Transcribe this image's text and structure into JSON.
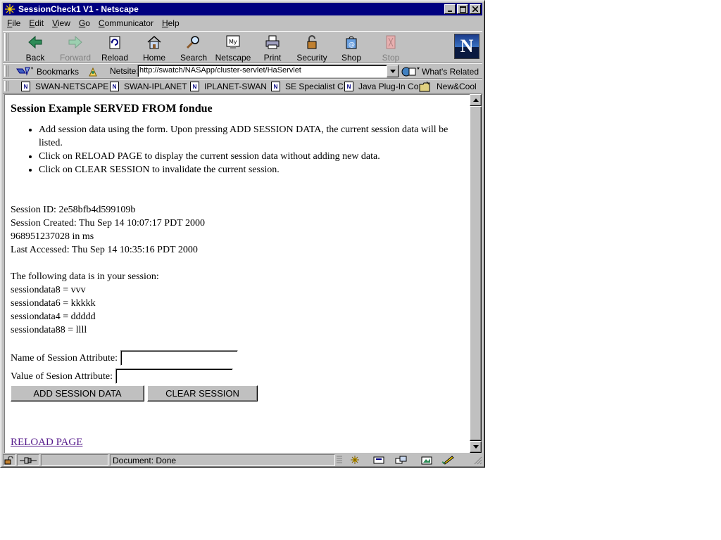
{
  "window": {
    "title": "SessionCheck1 V1 - Netscape",
    "controls": {
      "minimize": "_",
      "maximize": "□",
      "close": "×"
    }
  },
  "menu": [
    {
      "label": "File",
      "accel": "F",
      "rest": "ile"
    },
    {
      "label": "Edit",
      "accel": "E",
      "rest": "dit"
    },
    {
      "label": "View",
      "accel": "V",
      "rest": "iew"
    },
    {
      "label": "Go",
      "accel": "G",
      "rest": "o"
    },
    {
      "label": "Communicator",
      "accel": "C",
      "rest": "ommunicator"
    },
    {
      "label": "Help",
      "accel": "H",
      "rest": "elp"
    }
  ],
  "toolbar": {
    "back": "Back",
    "forward": "Forward",
    "reload": "Reload",
    "home": "Home",
    "search": "Search",
    "netscape": "Netscape",
    "print": "Print",
    "security": "Security",
    "shop": "Shop",
    "stop": "Stop",
    "logo": "N"
  },
  "location": {
    "bookmarks_label": "Bookmarks",
    "netsite_label": "Netsite:",
    "url": "http://swatch/NASApp/cluster-servlet/HaServlet",
    "related": "What's Related"
  },
  "personal_toolbar": [
    "SWAN-NETSCAPE",
    "SWAN-IPLANET",
    "IPLANET-SWAN",
    "SE Specialist C",
    "Java Plug-In Co",
    "New&Cool"
  ],
  "page": {
    "heading": "Session Example SERVED FROM fondue",
    "bullets": [
      "Add session data using the form. Upon pressing ADD SESSION DATA, the current session data will be listed.",
      "Click on RELOAD PAGE to display the current session data without adding new data.",
      "Click on CLEAR SESSION to invalidate the current session."
    ],
    "session_id": "Session ID: 2e58bfb4d599109b",
    "session_created": "Session Created: Thu Sep 14 10:07:17 PDT 2000",
    "created_ms": "968951237028 in ms",
    "last_accessed": "Last Accessed: Thu Sep 14 10:35:16 PDT 2000",
    "data_intro": "The following data is in your session:",
    "data_items": [
      "sessiondata8 = vvv",
      "sessiondata6 = kkkkk",
      "sessiondata4 = ddddd",
      "sessiondata88 = llll"
    ],
    "name_label": "Name of Session Attribute:",
    "name_value": "",
    "value_label": "Value of Sesion Attribute:",
    "value_value": "",
    "add_button": "ADD SESSION DATA",
    "clear_button": "CLEAR SESSION",
    "reload_link": "RELOAD PAGE"
  },
  "status": {
    "text": "Document: Done"
  },
  "colors": {
    "titlebar": "#000080",
    "chrome": "#c0c0c0",
    "visited_link": "#551a8b"
  }
}
